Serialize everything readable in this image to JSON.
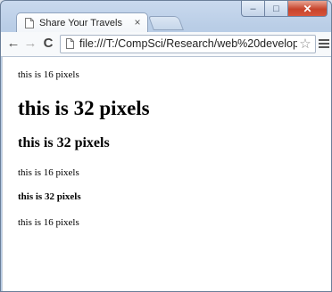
{
  "browser": {
    "tab": {
      "title": "Share Your Travels",
      "close_glyph": "×"
    },
    "window_controls": {
      "minimize": "–",
      "maximize": "□",
      "close": "✕"
    },
    "nav": {
      "back": "←",
      "forward": "→",
      "reload": "C"
    },
    "address": {
      "url": "file:///T:/CompSci/Research/web%20develop"
    },
    "bookmark_glyph": "☆",
    "icons": [
      "page-icon",
      "back-icon",
      "forward-icon",
      "reload-icon",
      "star-icon",
      "menu-icon"
    ]
  },
  "page": {
    "lines": [
      {
        "kind": "p",
        "text": "this is 16 pixels"
      },
      {
        "kind": "h1",
        "text": "this is 32 pixels"
      },
      {
        "kind": "h2",
        "text": "this is 32 pixels"
      },
      {
        "kind": "p",
        "text": "this is 16 pixels"
      },
      {
        "kind": "h4",
        "text": "this is 32 pixels"
      },
      {
        "kind": "p",
        "text": "this is 16 pixels"
      }
    ]
  }
}
